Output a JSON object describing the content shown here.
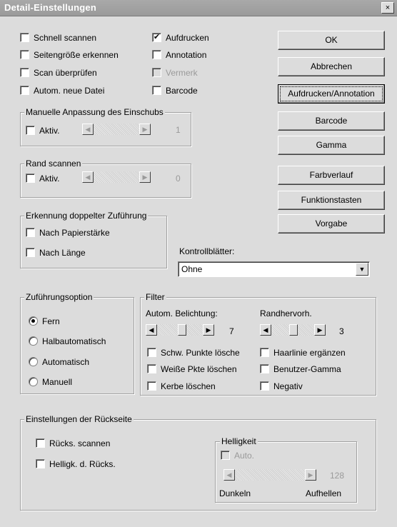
{
  "window": {
    "title": "Detail-Einstellungen",
    "close_glyph": "×"
  },
  "checks": {
    "schnell_scannen": "Schnell scannen",
    "seitengroesse": "Seitengröße erkennen",
    "scan_pruefen": "Scan überprüfen",
    "autom_neue_datei": "Autom. neue Datei",
    "aufdrucken": "Aufdrucken",
    "annotation": "Annotation",
    "vermerk": "Vermerk",
    "barcode": "Barcode"
  },
  "buttons": {
    "ok": "OK",
    "abbrechen": "Abbrechen",
    "aufdrucken_annotation": "Aufdrucken/Annotation",
    "barcode": "Barcode",
    "gamma": "Gamma",
    "farbverlauf": "Farbverlauf",
    "funktionstasten": "Funktionstasten",
    "vorgabe": "Vorgabe"
  },
  "manuelle_anpassung": {
    "title": "Manuelle Anpassung des Einschubs",
    "aktiv": "Aktiv.",
    "value": "1"
  },
  "rand_scannen": {
    "title": "Rand scannen",
    "aktiv": "Aktiv.",
    "value": "0"
  },
  "doppelte_zufuehrung": {
    "title": "Erkennung doppelter Zuführung",
    "papierstaerke": "Nach Papierstärke",
    "laenge": "Nach Länge"
  },
  "kontrollblaetter": {
    "label": "Kontrollblätter:",
    "value": "Ohne"
  },
  "zufuehrungsoption": {
    "title": "Zuführungsoption",
    "fern": "Fern",
    "halbautomatisch": "Halbautomatisch",
    "automatisch": "Automatisch",
    "manuell": "Manuell",
    "selected": "Fern"
  },
  "filter": {
    "title": "Filter",
    "belichtung_label": "Autom. Belichtung:",
    "belichtung_value": "7",
    "randhervorh_label": "Randhervorh.",
    "randhervorh_value": "3",
    "schw_punkte": "Schw. Punkte lösche",
    "haarlinie": "Haarlinie ergänzen",
    "weisse_pkte": "Weiße Pkte löschen",
    "benutzer_gamma": "Benutzer-Gamma",
    "kerbe": "Kerbe löschen",
    "negativ": "Negativ"
  },
  "rueckseite": {
    "title": "Einstellungen der Rückseite",
    "scannen": "Rücks. scannen",
    "helligk": "Helligk. d. Rücks.",
    "helligkeit_title": "Helligkeit",
    "auto": "Auto.",
    "value": "128",
    "dunkeln": "Dunkeln",
    "aufhellen": "Aufhellen"
  },
  "arrows": {
    "left": "◀",
    "right": "▶",
    "down": "▼"
  }
}
